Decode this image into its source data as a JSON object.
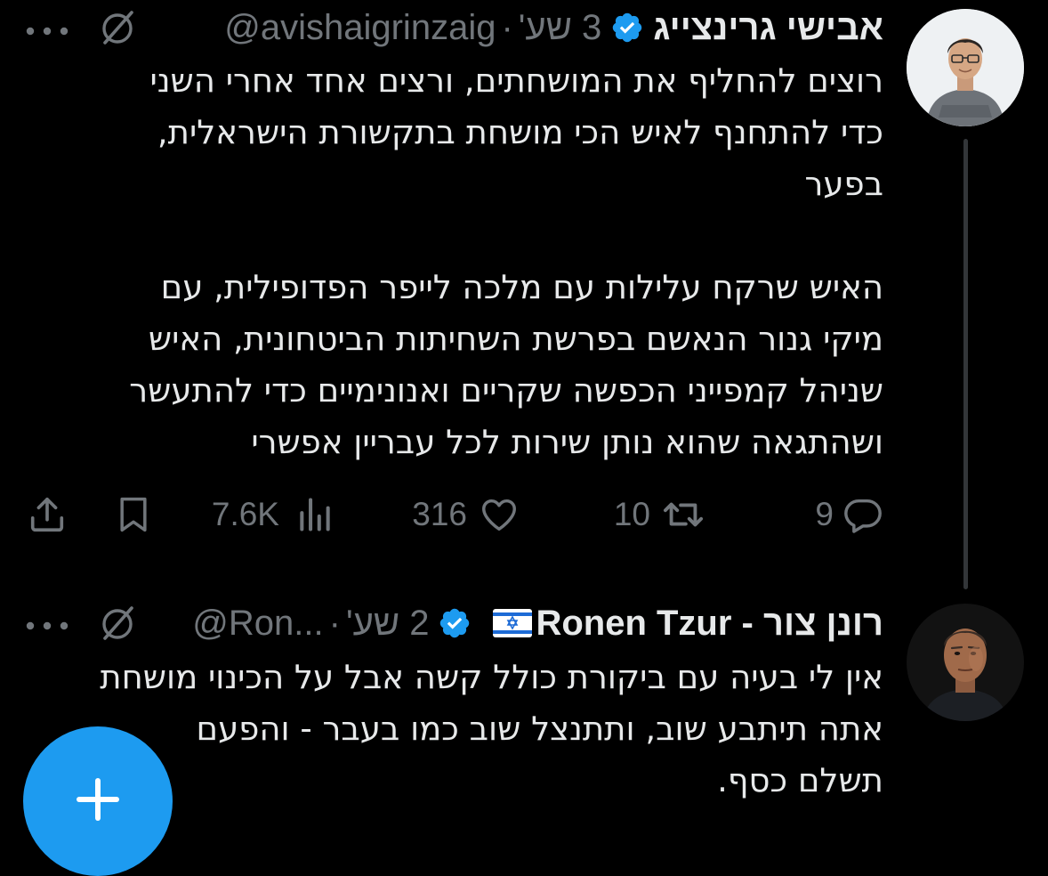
{
  "tweets": [
    {
      "display_name": "אבישי גרינצייג",
      "handle": "@avishaigrinzaig",
      "time": "3 שע'",
      "verified": true,
      "body_lines": [
        "רוצים להחליף את המושחתים, ורצים אחד אחרי השני",
        "כדי להתחנף לאיש הכי מושחת בתקשורת הישראלית,",
        "בפער",
        "",
        "האיש שרקח עלילות עם מלכה לייפר הפדופילית, עם",
        "מיקי גנור הנאשם בפרשת השחיתות הביטחונית, האיש",
        "שניהל קמפייני הכפשה שקריים ואנונימיים כדי להתעשר",
        "ושהתגאה שהוא נותן שירות לכל עבריין אפשרי"
      ],
      "actions": {
        "replies": "9",
        "retweets": "10",
        "likes": "316",
        "views": "7.6K"
      }
    },
    {
      "display_name": "רונן צור - Ronen Tzur",
      "flag": "israel-flag-icon",
      "handle": "@Ron...",
      "time": "2 שע'",
      "verified": true,
      "body_lines": [
        "אין לי בעיה עם ביקורת כולל קשה אבל על הכינוי מושחת",
        "אתה תיתבע שוב, ותתנצל שוב כמו בעבר - והפעם",
        "תשלם כסף."
      ]
    }
  ],
  "colors": {
    "background": "#000000",
    "primary_text": "#e7e9ea",
    "secondary_text": "#71767b",
    "accent": "#1d9bf0",
    "thread_line": "#333639"
  },
  "fab": {
    "icon": "plus-icon"
  }
}
